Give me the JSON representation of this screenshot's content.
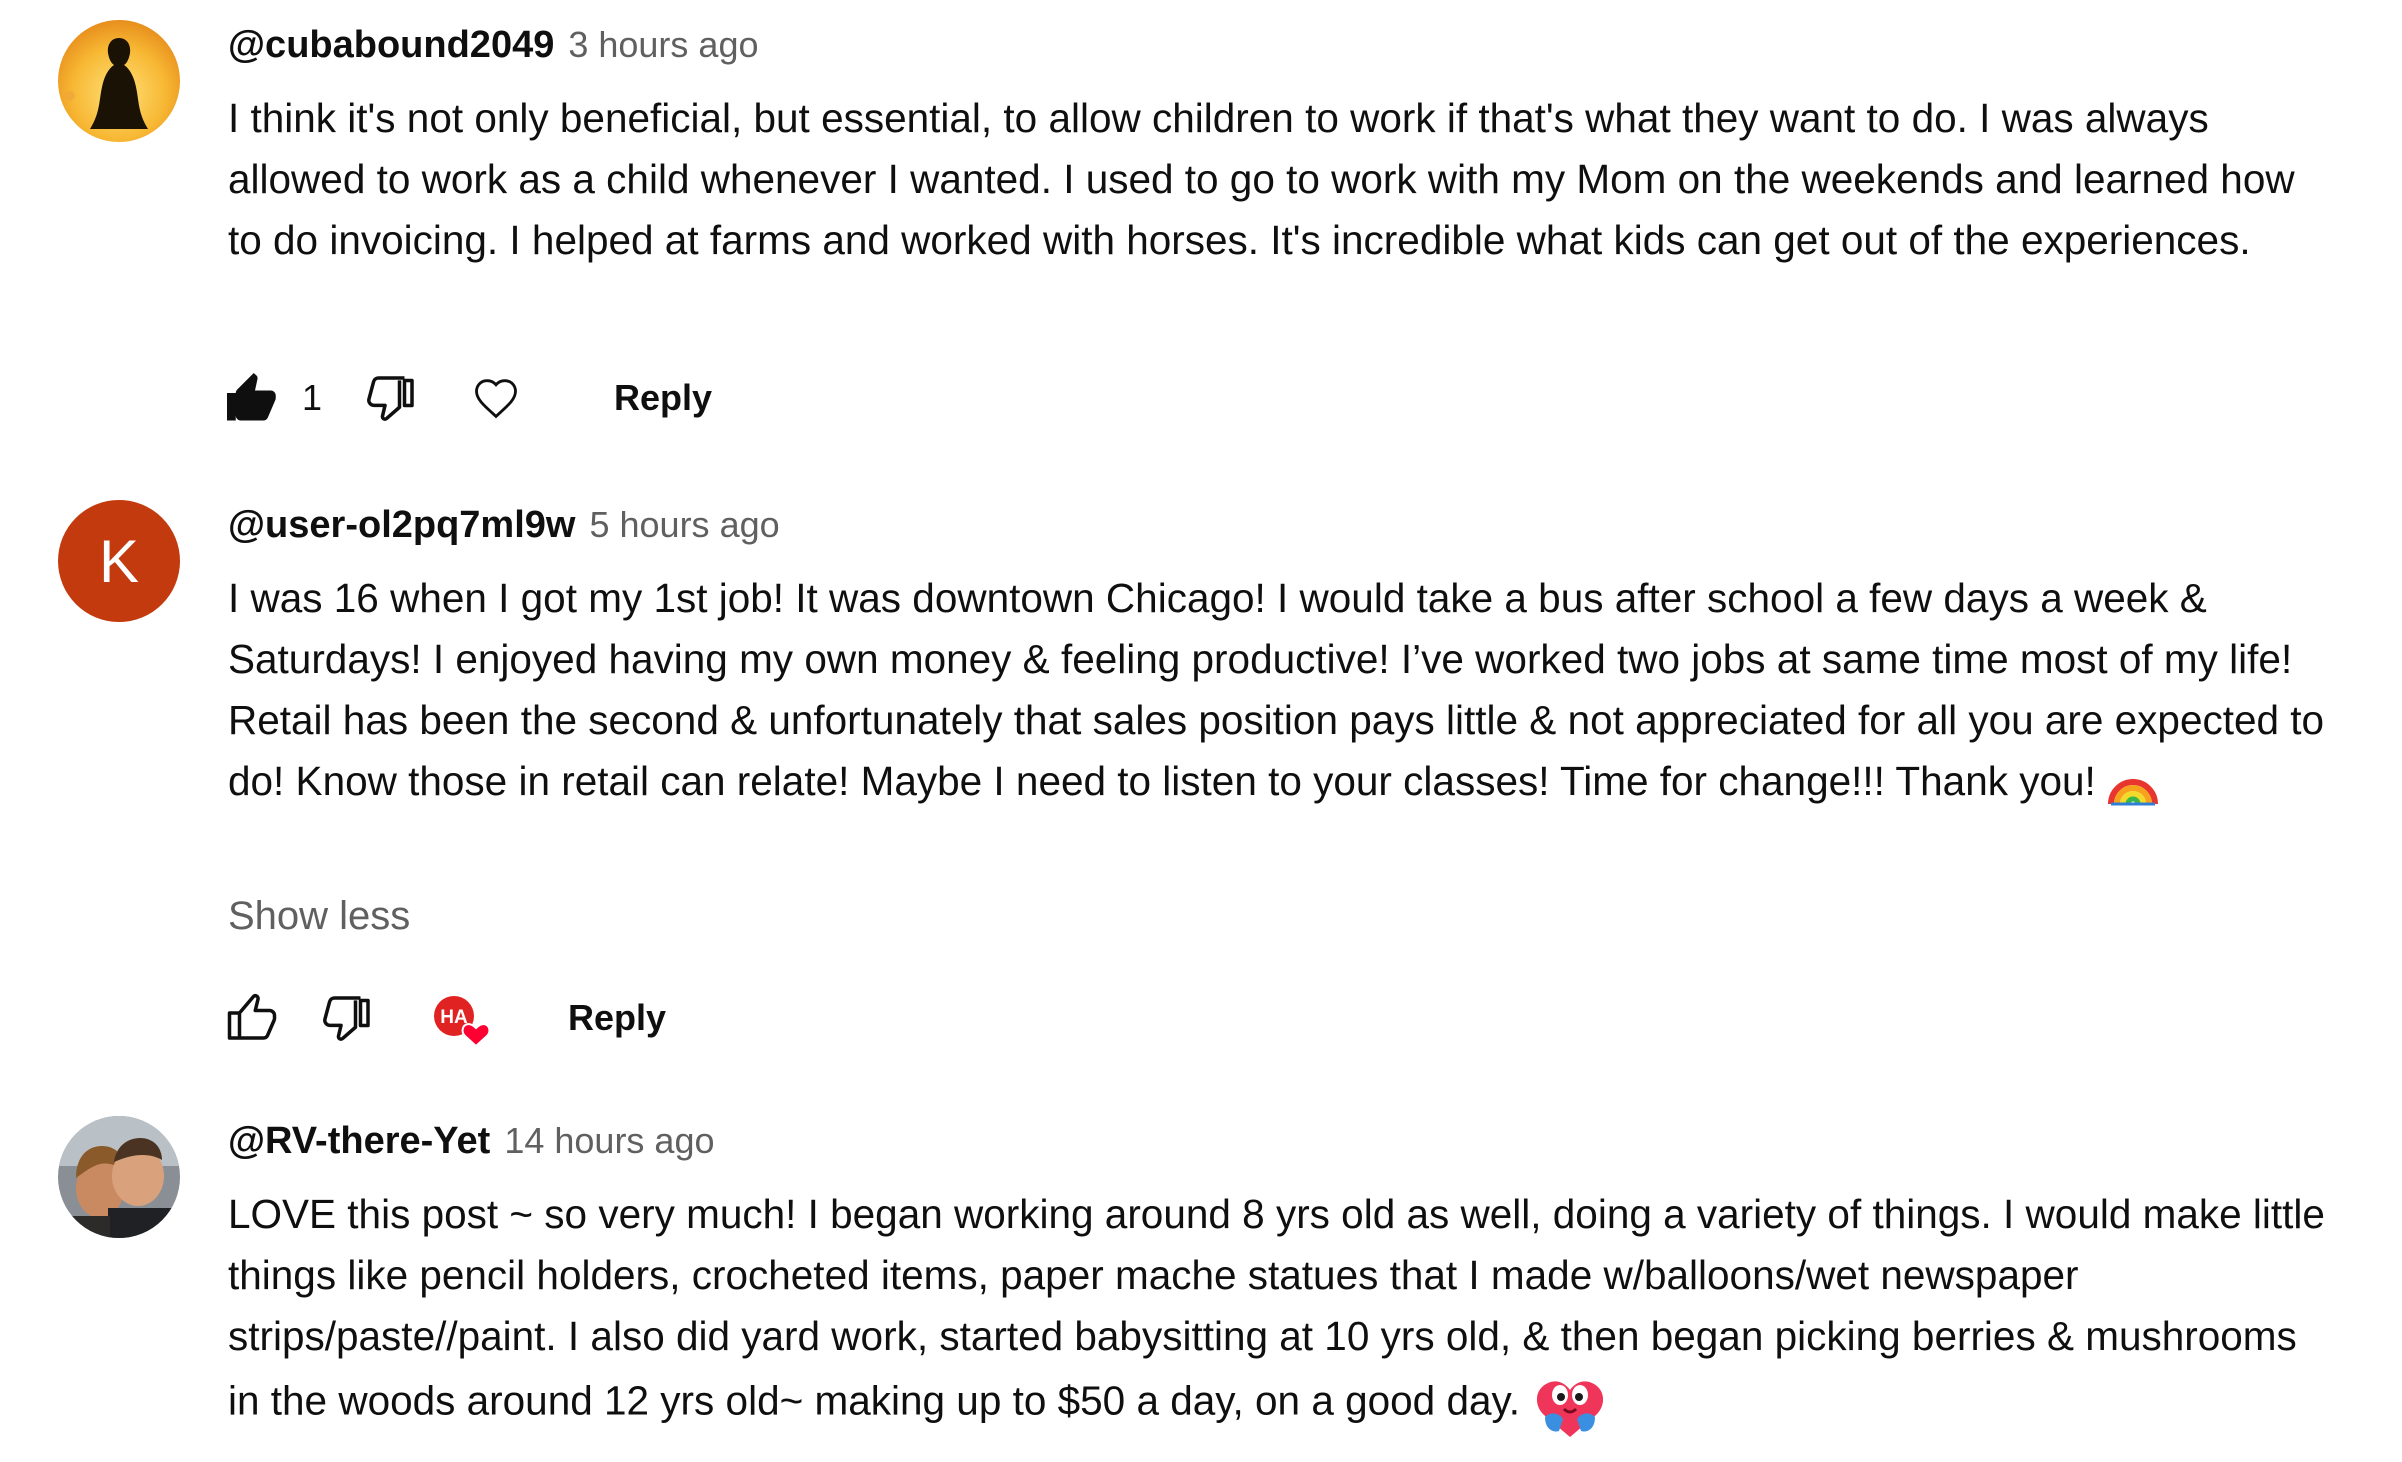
{
  "comments": [
    {
      "author": "@cubabound2049",
      "timestamp": "3 hours ago",
      "text": "I think it's not only beneficial, but essential, to allow children to work if that's what they want to do. I was always allowed to work as a child whenever I wanted. I used to go to work with my Mom on the weekends and learned how to do invoicing. I helped at farms and worked with horses. It's incredible what kids can get out of the experiences.",
      "like_count": "1",
      "reply_label": "Reply",
      "liked": true,
      "creator_heart": false
    },
    {
      "author": "@user-ol2pq7ml9w",
      "avatar_letter": "K",
      "avatar_color": "#c23a0e",
      "timestamp": "5 hours ago",
      "text": "I was 16 when I got my 1st job! It was downtown Chicago! I would take a bus after school a few days a week & Saturdays! I enjoyed having my own money & feeling productive! I’ve worked two jobs at same time most of my life! Retail has been the second & unfortunately that sales position pays little & not appreciated for all you are expected to do! Know those in retail can relate! Maybe I need to listen to your classes! Time for change!!! Thank you!",
      "emoji": "rainbow-emoji",
      "show_less_label": "Show less",
      "reply_label": "Reply",
      "liked": false,
      "creator_heart": true,
      "creator_heart_initials": "HA"
    },
    {
      "author": "@RV-there-Yet",
      "timestamp": "14 hours ago",
      "text": "LOVE this post ~ so very much! I began working around 8 yrs old as well, doing a variety of things. I would make little things like pencil holders, crocheted items, paper mache statues that I made w/balloons/wet newspaper strips/paste//paint. I also did yard work, started babysitting at 10 yrs old, & then began picking berries & mushrooms in the woods around 12  yrs old~ making up to $50 a day, on a good day.",
      "emoji": "hugging-face-emoji"
    }
  ],
  "colors": {
    "text_primary": "#0f0f0f",
    "text_secondary": "#606060",
    "heart_red": "#ff0033"
  }
}
